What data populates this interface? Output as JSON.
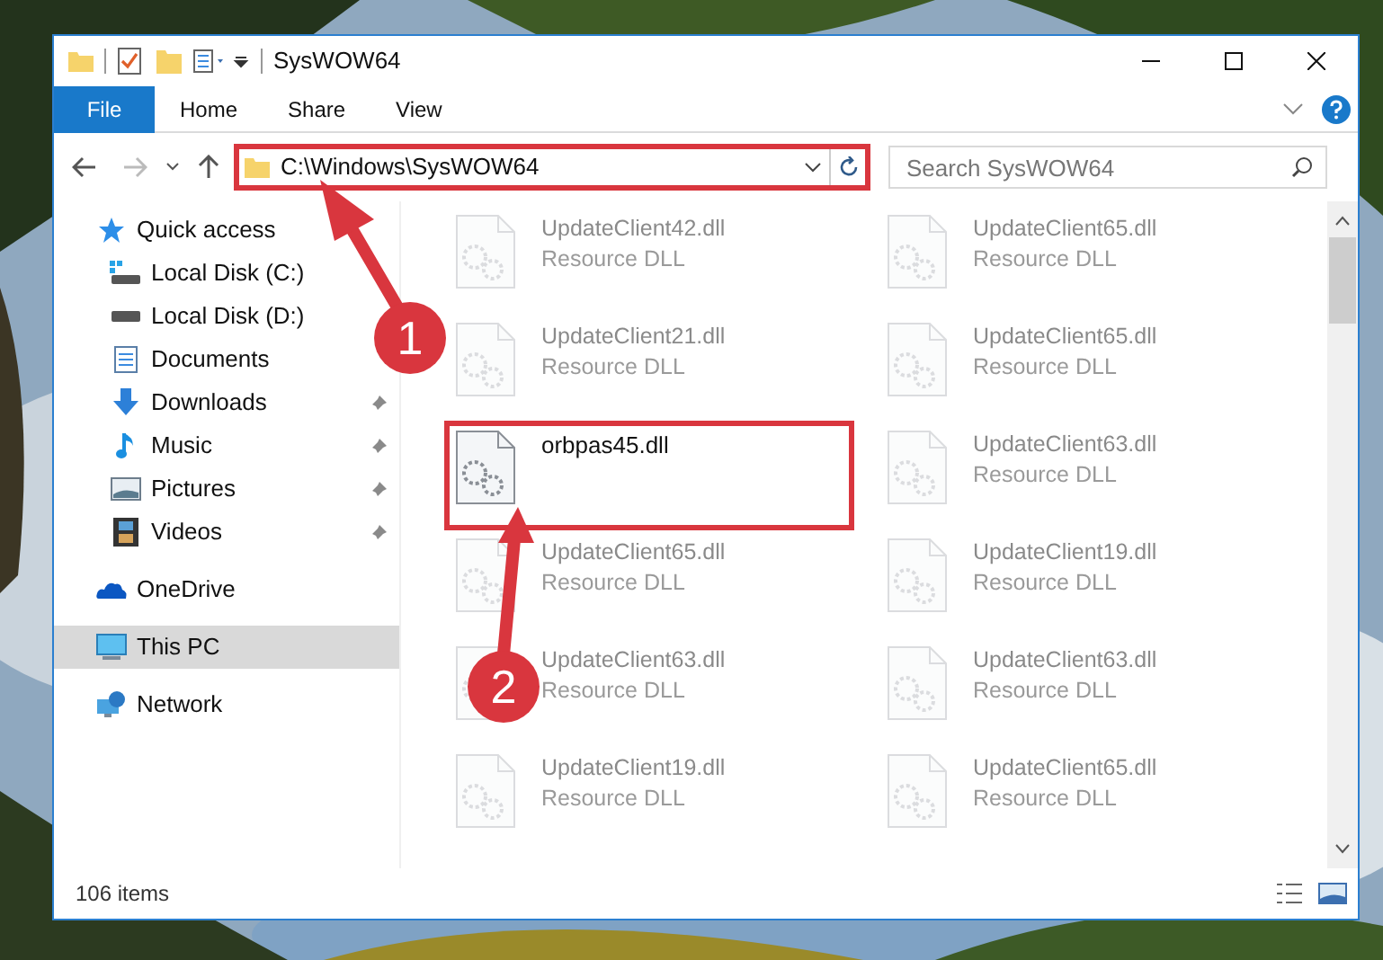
{
  "window": {
    "title": "SysWOW64"
  },
  "ribbon": {
    "file_button": "File",
    "tabs": [
      "Home",
      "Share",
      "View"
    ]
  },
  "address_bar": {
    "path": "C:\\Windows\\SysWOW64"
  },
  "search": {
    "placeholder": "Search SysWOW64"
  },
  "navigation": [
    {
      "label": "Quick access",
      "selected": false,
      "children": [
        {
          "label": "Local Disk (C:)",
          "pinned": false,
          "selected": false
        },
        {
          "label": "Local Disk (D:)",
          "pinned": false,
          "selected": false
        },
        {
          "label": "Documents",
          "pinned": false,
          "selected": false
        },
        {
          "label": "Downloads",
          "pinned": true,
          "selected": false
        },
        {
          "label": "Music",
          "pinned": true,
          "selected": false
        },
        {
          "label": "Pictures",
          "pinned": true,
          "selected": false
        },
        {
          "label": "Videos",
          "pinned": true,
          "selected": false
        }
      ]
    },
    {
      "label": "OneDrive",
      "selected": false
    },
    {
      "label": "This PC",
      "selected": true
    },
    {
      "label": "Network",
      "selected": false
    }
  ],
  "files": [
    {
      "name": "UpdateClient42.dll",
      "type": "Resource DLL",
      "dimmed": true
    },
    {
      "name": "UpdateClient65.dll",
      "type": "Resource DLL",
      "dimmed": true
    },
    {
      "name": "UpdateClient21.dll",
      "type": "Resource DLL",
      "dimmed": true
    },
    {
      "name": "UpdateClient65.dll",
      "type": "Resource DLL",
      "dimmed": true
    },
    {
      "name": "orbpas45.dll",
      "dimmed": false
    },
    {
      "name": "UpdateClient63.dll",
      "type": "Resource DLL",
      "dimmed": true
    },
    {
      "name": "UpdateClient65.dll",
      "type": "Resource DLL",
      "dimmed": true
    },
    {
      "name": "UpdateClient19.dll",
      "type": "Resource DLL",
      "dimmed": true
    },
    {
      "name": "UpdateClient63.dll",
      "type": "Resource DLL",
      "dimmed": true
    },
    {
      "name": "UpdateClient63.dll",
      "type": "Resource DLL",
      "dimmed": true
    },
    {
      "name": "UpdateClient19.dll",
      "type": "Resource DLL",
      "dimmed": true
    },
    {
      "name": "UpdateClient65.dll",
      "type": "Resource DLL",
      "dimmed": true
    }
  ],
  "status_bar": {
    "item_count": "106 items"
  },
  "annotations": [
    {
      "label": "1"
    },
    {
      "label": "2"
    }
  ]
}
